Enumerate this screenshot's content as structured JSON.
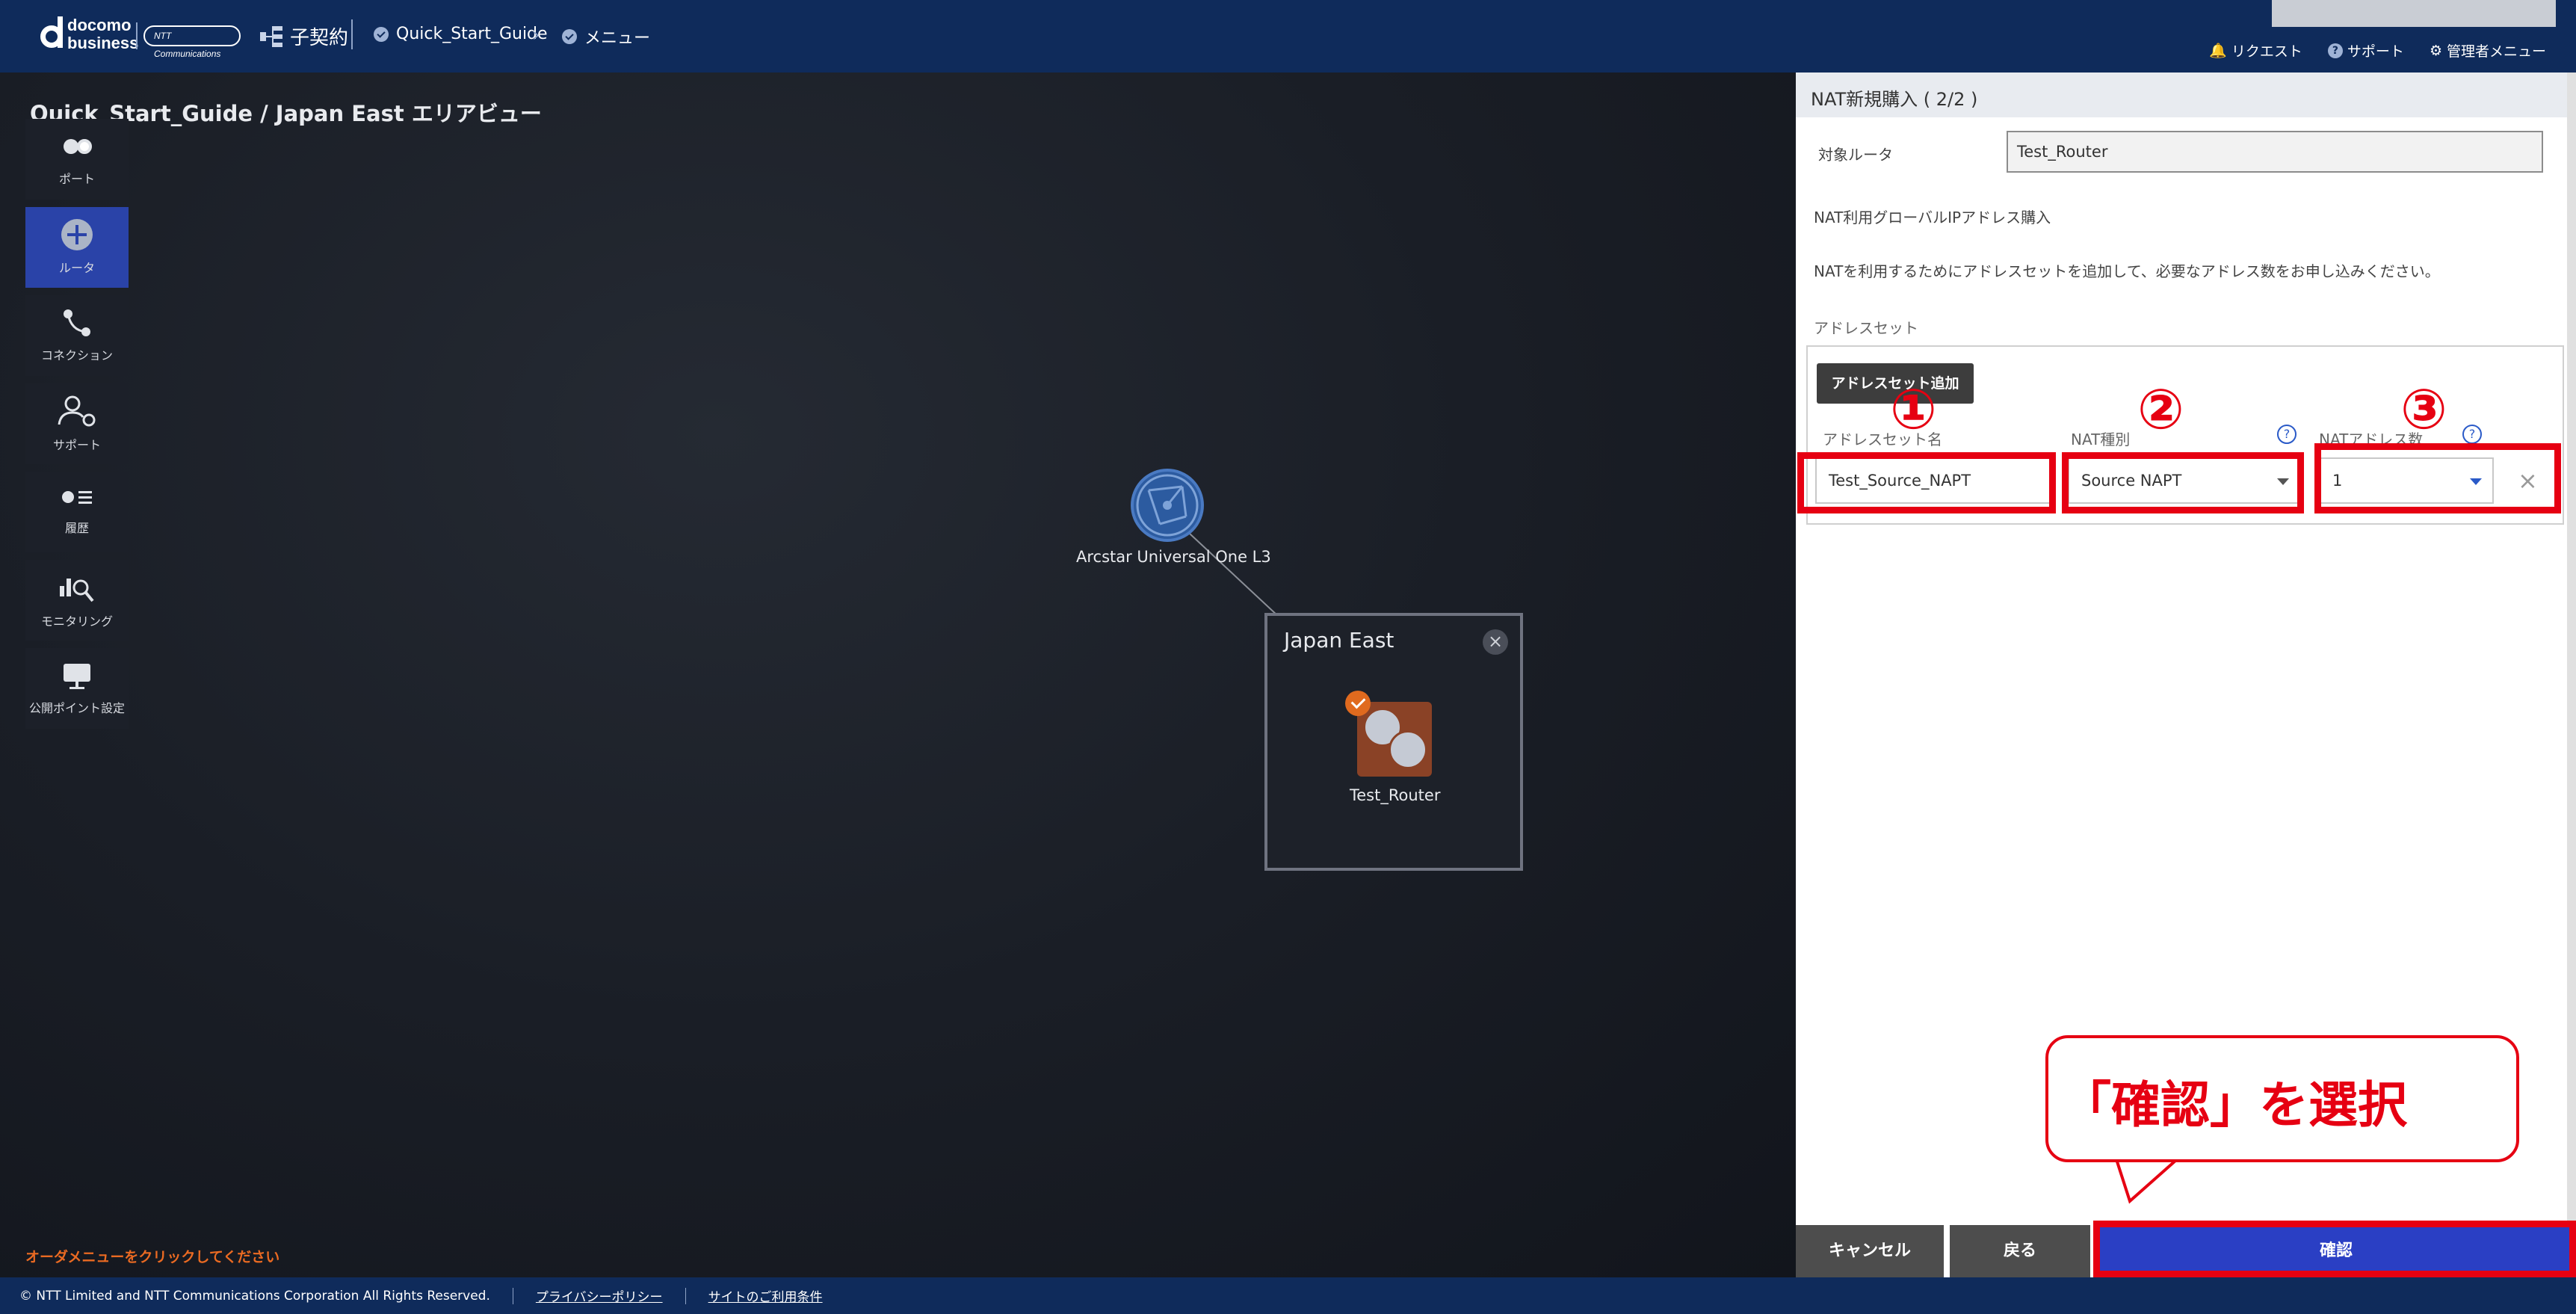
{
  "header": {
    "brand_line1": "docomo",
    "brand_line2": "business",
    "ntt_logo_text": "NTT Communications",
    "child_contract": "子契約",
    "breadcrumb_1": "Quick_Start_Guide",
    "breadcrumb_2": "メニュー",
    "nav_request": "リクエスト",
    "nav_support": "サポート",
    "nav_admin": "管理者メニュー"
  },
  "canvas": {
    "area_title": "Quick_Start_Guide / Japan East エリアビュー",
    "sidebar": [
      {
        "label": "ポート",
        "icon": "port-icon",
        "active": false
      },
      {
        "label": "ルータ",
        "icon": "router-icon",
        "active": true
      },
      {
        "label": "コネクション",
        "icon": "connection-icon",
        "active": false
      },
      {
        "label": "サポート",
        "icon": "support-icon",
        "active": false
      },
      {
        "label": "履歴",
        "icon": "history-icon",
        "active": false
      },
      {
        "label": "モニタリング",
        "icon": "monitoring-icon",
        "active": false
      },
      {
        "label": "公開ポイント設定",
        "icon": "public-point-icon",
        "active": false
      }
    ],
    "globe_label": "Arcstar Universal One L3",
    "region_title": "Japan East",
    "router_label": "Test_Router",
    "order_hint": "オーダメニューをクリックしてください"
  },
  "panel": {
    "title": "NAT新規購入 ( 2/2 )",
    "target_router_label": "対象ルータ",
    "target_router_value": "Test_Router",
    "global_ip_label": "NAT利用グローバルIPアドレス購入",
    "description": "NATを利用するためにアドレスセットを追加して、必要なアドレス数をお申し込みください。",
    "address_set_label": "アドレスセット",
    "add_button": "アドレスセット追加",
    "col_name": "アドレスセット名",
    "col_type": "NAT種別",
    "col_count": "NATアドレス数",
    "value_name": "Test_Source_NAPT",
    "value_type": "Source NAPT",
    "value_count": "1",
    "marker_1": "①",
    "marker_2": "②",
    "marker_3": "③",
    "callout": "「確認」を選択",
    "btn_cancel": "キャンセル",
    "btn_back": "戻る",
    "btn_confirm": "確認"
  },
  "footer": {
    "copyright": "© NTT Limited and NTT Communications Corporation All Rights Reserved.",
    "privacy": "プライバシーポリシー",
    "terms": "サイトのご利用条件"
  },
  "colors": {
    "header_bg": "#0f2b5b",
    "active_nav": "#2a43a8",
    "confirm_btn": "#2a3fc4",
    "annotation_red": "#e60012",
    "hint_orange": "#ea6a22"
  }
}
